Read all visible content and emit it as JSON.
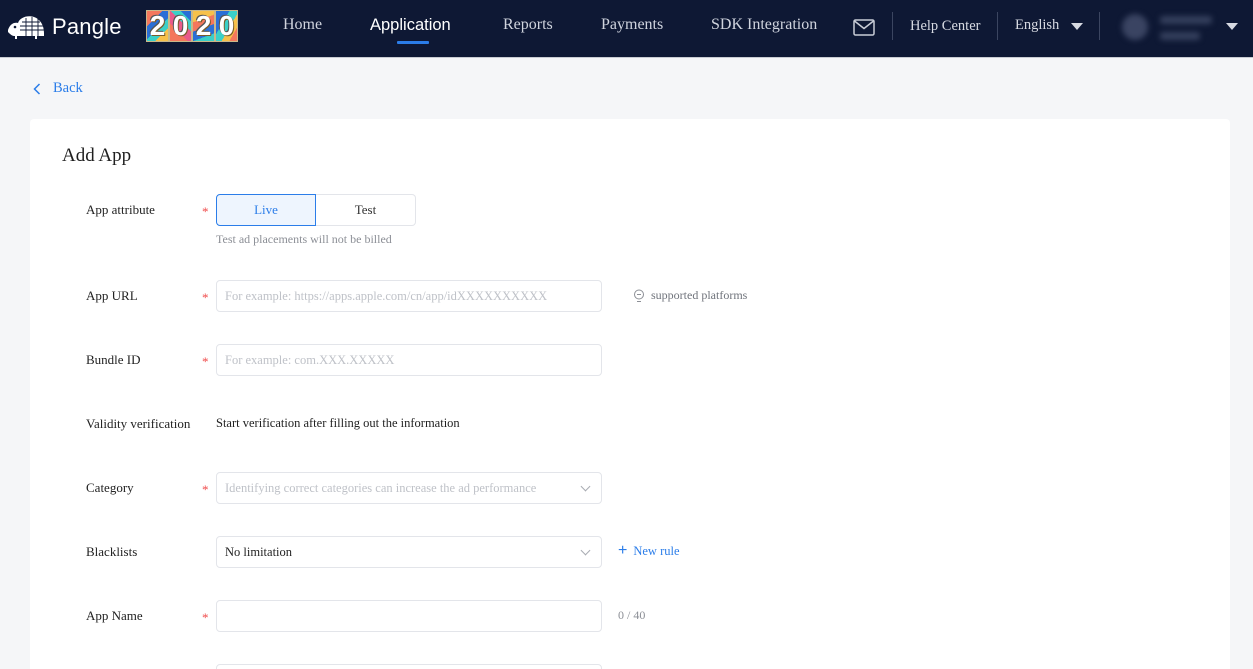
{
  "header": {
    "brand": "Pangle",
    "badge_digits": [
      "2",
      "0",
      "2",
      "0"
    ],
    "nav": [
      {
        "label": "Home",
        "active": false
      },
      {
        "label": "Application",
        "active": true
      },
      {
        "label": "Reports",
        "active": false
      },
      {
        "label": "Payments",
        "active": false
      },
      {
        "label": "SDK Integration",
        "active": false
      }
    ],
    "help_center": "Help Center",
    "language": "English",
    "icons": {
      "mail": "mail-icon",
      "language_caret": "caret-down-icon",
      "user_caret": "caret-down-icon"
    },
    "accent_color": "#2b7de9",
    "bar_color": "#0e1834"
  },
  "page": {
    "back_label": "Back",
    "title": "Add App"
  },
  "form": {
    "app_attribute": {
      "label": "App attribute",
      "required": "*",
      "options": [
        {
          "label": "Live",
          "selected": true
        },
        {
          "label": "Test",
          "selected": false
        }
      ],
      "hint": "Test ad placements will not be billed"
    },
    "app_url": {
      "label": "App URL",
      "required": "*",
      "value": "",
      "placeholder": "For example: https://apps.apple.com/cn/app/idXXXXXXXXXX",
      "help_link": "supported platforms"
    },
    "bundle_id": {
      "label": "Bundle ID",
      "required": "*",
      "value": "",
      "placeholder": "For example: com.XXX.XXXXX"
    },
    "validity": {
      "label": "Validity verification",
      "text": "Start verification after filling out the information"
    },
    "category": {
      "label": "Category",
      "required": "*",
      "placeholder": "Identifying correct categories can increase the ad performance"
    },
    "blacklists": {
      "label": "Blacklists",
      "value": "No limitation",
      "new_rule_label": "New rule",
      "new_rule_icon": "+"
    },
    "app_name": {
      "label": "App Name",
      "required": "*",
      "value": "",
      "placeholder": "",
      "counter": "0 / 40"
    }
  },
  "required_color": "#f04b4b"
}
